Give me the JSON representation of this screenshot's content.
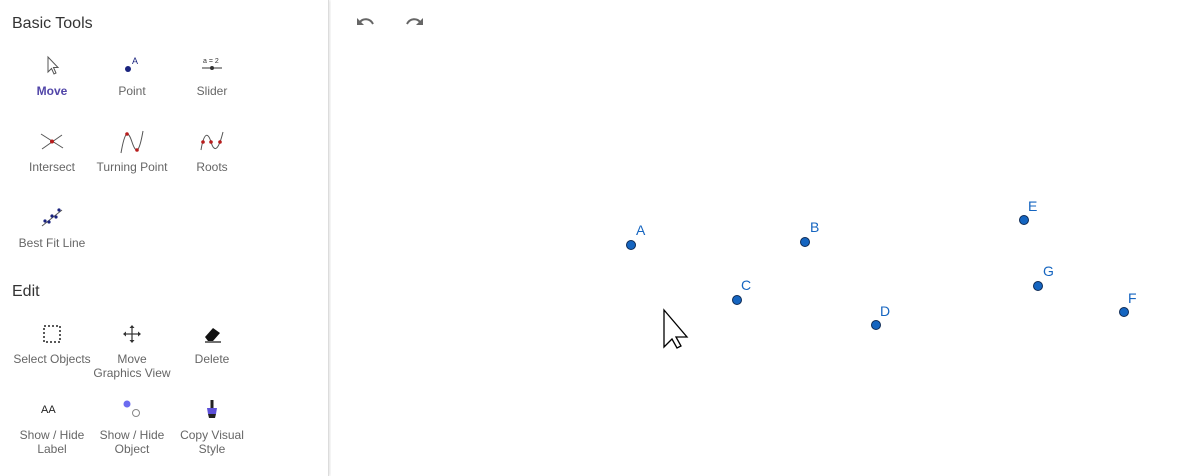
{
  "sections": {
    "basic_tools": "Basic Tools",
    "edit": "Edit"
  },
  "tools": {
    "move": "Move",
    "point": "Point",
    "slider": "Slider",
    "intersect": "Intersect",
    "turning_point": "Turning Point",
    "roots": "Roots",
    "best_fit_line": "Best Fit Line",
    "select_objects": "Select Objects",
    "move_graphics_view": [
      "Move",
      "Graphics View"
    ],
    "delete": "Delete",
    "show_hide_label": [
      "Show / Hide",
      "Label"
    ],
    "show_hide_object": [
      "Show / Hide",
      "Object"
    ],
    "copy_visual_style": [
      "Copy Visual",
      "Style"
    ]
  },
  "icon_text": {
    "point_letter": "A",
    "slider_text": "a = 2",
    "label_icon_text": "AA"
  },
  "toolbar": {
    "undo_icon": "undo-icon",
    "redo_icon": "redo-icon"
  },
  "points": [
    {
      "label": "A"
    },
    {
      "label": "B"
    },
    {
      "label": "C"
    },
    {
      "label": "D"
    },
    {
      "label": "E"
    },
    {
      "label": "G"
    },
    {
      "label": "F"
    }
  ],
  "colors": {
    "point_fill": "#1565c0",
    "point_label": "#1565c0",
    "active_tool": "#5145a8"
  }
}
